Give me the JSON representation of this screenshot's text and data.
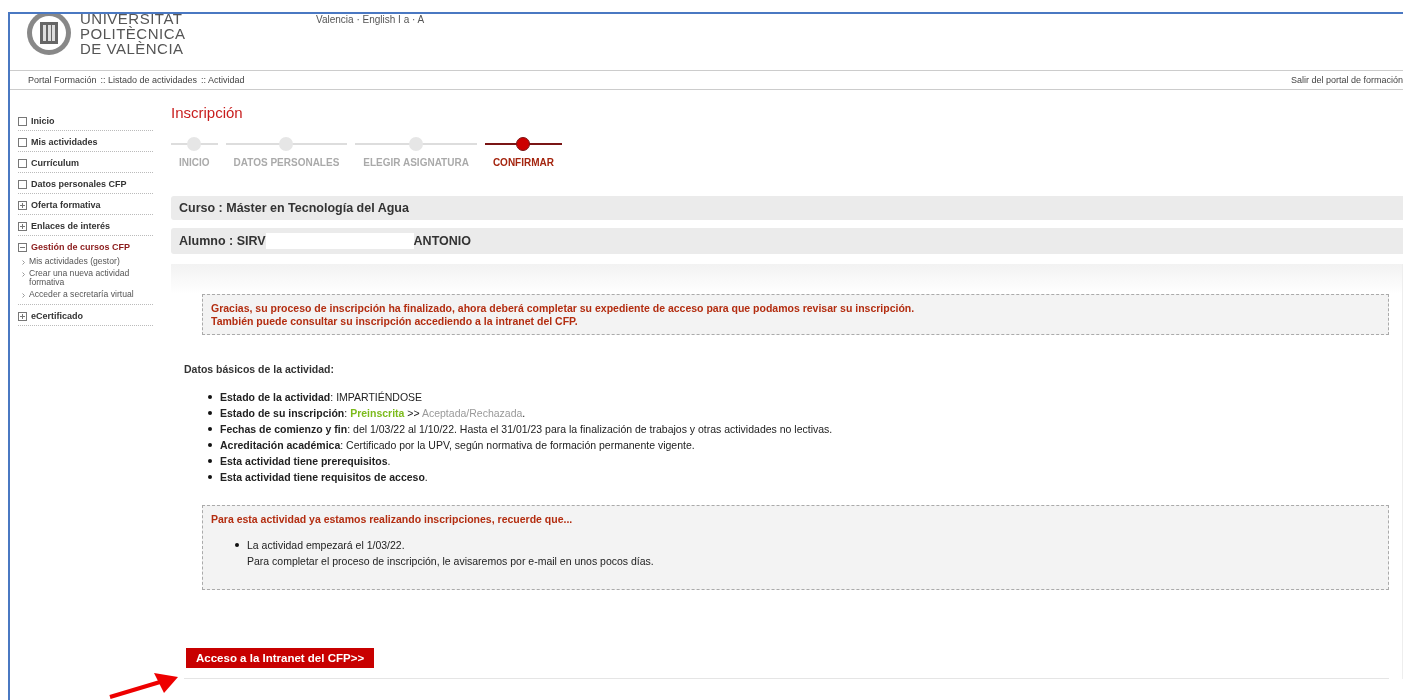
{
  "header": {
    "logo_lines": [
      "UNIVERSITAT",
      "POLITÈCNICA",
      "DE VALÈNCIA"
    ],
    "top_links": "Valencia · English  I  a · A"
  },
  "breadcrumb": {
    "items": [
      "Portal Formación",
      ":: Listado de actividades",
      ":: Actividad"
    ],
    "logout": "Salir del portal de formación"
  },
  "sidebar": {
    "items": [
      {
        "kind": "page",
        "label": "Inicio",
        "selected": false
      },
      {
        "kind": "page",
        "label": "Mis actividades",
        "selected": false
      },
      {
        "kind": "page",
        "label": "Currículum",
        "selected": false
      },
      {
        "kind": "page",
        "label": "Datos personales CFP",
        "selected": false
      },
      {
        "kind": "group",
        "label": "Oferta formativa",
        "selected": false,
        "expanded": false
      },
      {
        "kind": "group",
        "label": "Enlaces de interés",
        "selected": false,
        "expanded": false
      },
      {
        "kind": "group",
        "label": "Gestión de cursos CFP",
        "selected": true,
        "expanded": true,
        "children": [
          "Mis actividades (gestor)",
          "Crear una nueva actividad formativa",
          "Acceder a secretaría virtual"
        ]
      },
      {
        "kind": "group",
        "label": "eCertificado",
        "selected": false,
        "expanded": false
      }
    ]
  },
  "main": {
    "title": "Inscripción",
    "steps": [
      {
        "label": "INICIO",
        "selected": false
      },
      {
        "label": "DATOS PERSONALES",
        "selected": false
      },
      {
        "label": "ELEGIR ASIGNATURA",
        "selected": false
      },
      {
        "label": "CONFIRMAR",
        "selected": true
      }
    ],
    "course": "Curso : Máster en Tecnología del Agua",
    "student": {
      "label": "Alumno :",
      "name_start": "SIRV",
      "name_end": "ANTONIO"
    },
    "notice": [
      "Gracias, su proceso de inscripción ha finalizado, ahora deberá completar su expediente de acceso para que podamos revisar su inscripción.",
      "También puede consultar su inscripción accediendo a la intranet del CFP."
    ],
    "details_heading": "Datos básicos de la actividad:",
    "details": [
      [
        {
          "kind": "label",
          "text": "Estado de la actividad"
        },
        {
          "kind": "text",
          "text": ": IMPARTIÉNDOSE"
        }
      ],
      [
        {
          "kind": "label",
          "text": "Estado de su inscripción"
        },
        {
          "kind": "text",
          "text": ": "
        },
        {
          "kind": "current",
          "text": "Preinscrita"
        },
        {
          "kind": "text",
          "text": " >> "
        },
        {
          "kind": "pending",
          "text": "Aceptada/Rechazada"
        },
        {
          "kind": "text",
          "text": "."
        }
      ],
      [
        {
          "kind": "label",
          "text": "Fechas de comienzo y fin"
        },
        {
          "kind": "text",
          "text": ": del 1/03/22 al 1/10/22. Hasta el 31/01/23 para la finalización de trabajos y otras actividades no lectivas."
        }
      ],
      [
        {
          "kind": "label",
          "text": "Acreditación académica"
        },
        {
          "kind": "text",
          "text": ": Certificado por la UPV, según normativa de formación permanente vigente."
        }
      ],
      [
        {
          "kind": "label",
          "text": "Esta actividad tiene prerequisitos"
        },
        {
          "kind": "text",
          "text": "."
        }
      ],
      [
        {
          "kind": "label",
          "text": "Esta actividad tiene requisitos de acceso"
        },
        {
          "kind": "text",
          "text": "."
        }
      ]
    ],
    "reminder": {
      "title": "Para esta actividad ya estamos realizando inscripciones, recuerde que...",
      "items": [
        [
          "La actividad empezará el 1/03/22.",
          "Para completar el proceso de inscripción, le avisaremos por e-mail en unos pocos días."
        ]
      ]
    },
    "button": "Acceso a la Intranet del CFP>>"
  }
}
